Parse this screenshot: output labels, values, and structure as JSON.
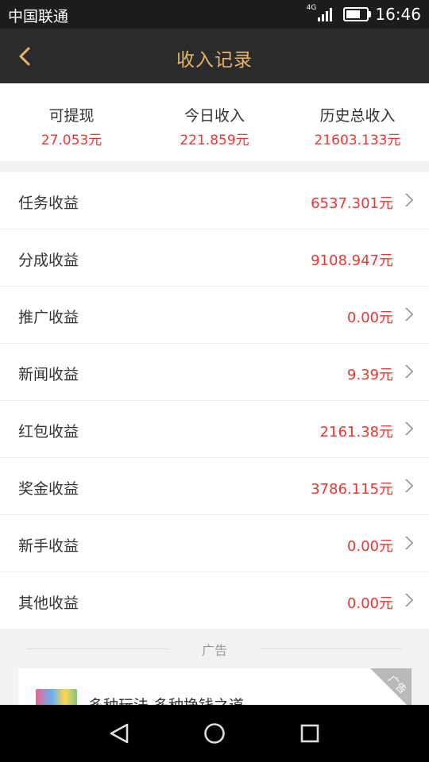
{
  "status_bar": {
    "carrier": "中国联通",
    "network": "4G",
    "time": "16:46",
    "battery_level": 0.7
  },
  "header": {
    "title": "收入记录"
  },
  "summary": [
    {
      "label": "可提现",
      "value": "27.053元"
    },
    {
      "label": "今日收入",
      "value": "221.859元"
    },
    {
      "label": "历史总收入",
      "value": "21603.133元"
    }
  ],
  "income_list": [
    {
      "label": "任务收益",
      "value": "6537.301元",
      "has_arrow": true
    },
    {
      "label": "分成收益",
      "value": "9108.947元",
      "has_arrow": false
    },
    {
      "label": "推广收益",
      "value": "0.00元",
      "has_arrow": true
    },
    {
      "label": "新闻收益",
      "value": "9.39元",
      "has_arrow": true
    },
    {
      "label": "红包收益",
      "value": "2161.38元",
      "has_arrow": true
    },
    {
      "label": "奖金收益",
      "value": "3786.115元",
      "has_arrow": true
    },
    {
      "label": "新手收益",
      "value": "0.00元",
      "has_arrow": true
    },
    {
      "label": "其他收益",
      "value": "0.00元",
      "has_arrow": true
    }
  ],
  "ad": {
    "section_label": "广告",
    "corner_tag": "广告",
    "title": "多种玩法 多种挣钱之道"
  },
  "colors": {
    "accent_gold": "#e6b66c",
    "value_red": "#e53935",
    "header_bg": "#2b2b2b"
  },
  "icons": {
    "back": "chevron-left-icon",
    "row_arrow": "chevron-right-icon",
    "nav_back": "triangle-back-icon",
    "nav_home": "circle-home-icon",
    "nav_recent": "square-recent-icon"
  }
}
